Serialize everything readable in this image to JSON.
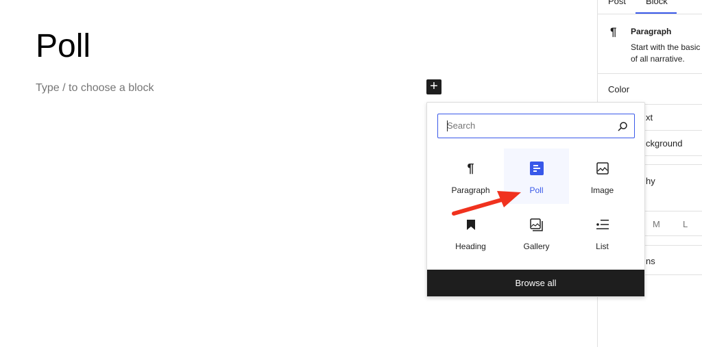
{
  "editor": {
    "title": "Poll",
    "placeholder": "Type / to choose a block",
    "add_block": "+"
  },
  "sidebar": {
    "tabs": [
      {
        "label": "Post"
      },
      {
        "label": "Block",
        "active": true
      }
    ],
    "block_name": "Paragraph",
    "block_desc_1": "Start with the basic",
    "block_desc_2": "of all narrative.",
    "color_heading": "Color",
    "text_fragment": "xt",
    "background_fragment": "ckground",
    "typography_fragment": "hy",
    "size_m": "M",
    "size_l": "L",
    "dimensions_fragment": "ns"
  },
  "inserter": {
    "search_placeholder": "Search",
    "blocks": [
      {
        "label": "Paragraph",
        "icon": "paragraph-icon"
      },
      {
        "label": "Poll",
        "icon": "poll-icon",
        "highlighted": true
      },
      {
        "label": "Image",
        "icon": "image-icon"
      },
      {
        "label": "Heading",
        "icon": "bookmark-icon"
      },
      {
        "label": "Gallery",
        "icon": "gallery-icon"
      },
      {
        "label": "List",
        "icon": "list-icon"
      }
    ],
    "browse_all": "Browse all"
  },
  "colors": {
    "accent": "#3858e9",
    "arrow": "#f0321e",
    "dark": "#1e1e1e"
  }
}
